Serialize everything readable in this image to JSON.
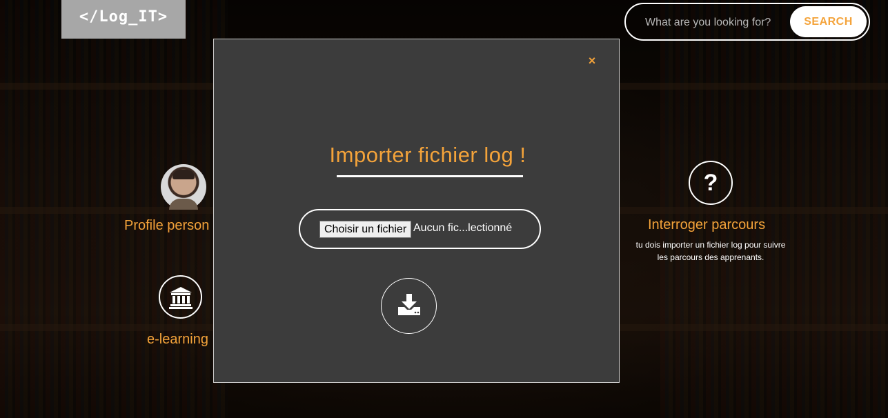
{
  "header": {
    "logo_text": "</Log_IT>",
    "search": {
      "placeholder": "What are you looking for?",
      "button_label": "SEARCH"
    }
  },
  "features": [
    {
      "title": "Profile person",
      "icon": "user-avatar"
    },
    {
      "title": "e-learning",
      "icon": "institution-icon"
    },
    {
      "title": "Interroger parcours",
      "icon": "question-icon",
      "description_line1": "tu dois importer un fichier log pour suivre",
      "description_line2": "les parcours des apprenants."
    }
  ],
  "modal": {
    "close_label": "×",
    "title": "Importer fichier log !",
    "file_button_label": "Choisir un fichier",
    "file_name": "Aucun fic...lectionné",
    "submit_icon": "download-icon"
  },
  "colors": {
    "accent": "#f4a33a",
    "modal_bg": "#3c3c3c",
    "logo_bg": "#a7a7a7"
  }
}
